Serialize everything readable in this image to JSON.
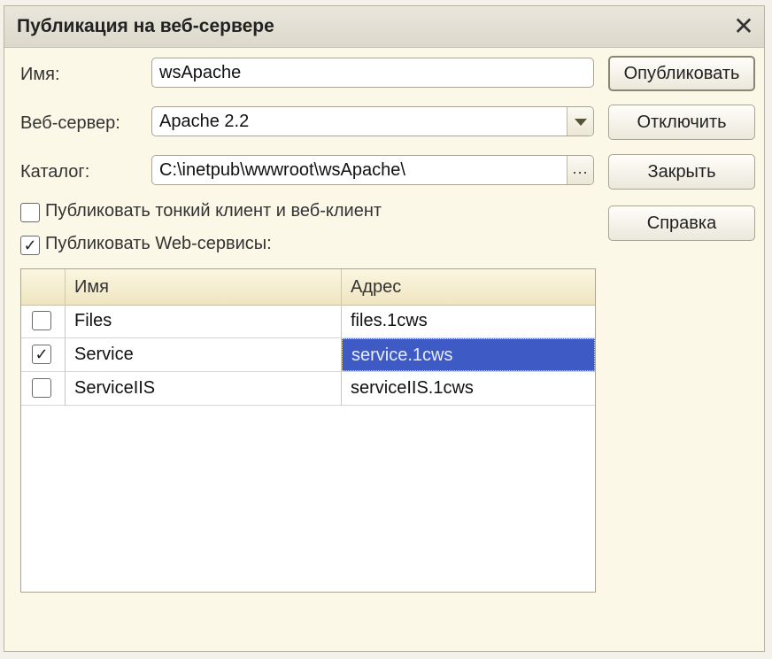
{
  "dialog": {
    "title": "Публикация на веб-сервере"
  },
  "form": {
    "name_label": "Имя:",
    "name_value": "wsApache",
    "server_label": "Веб-сервер:",
    "server_value": "Apache 2.2",
    "catalog_label": "Каталог:",
    "catalog_value": "C:\\inetpub\\wwwroot\\wsApache\\",
    "catalog_button": "..."
  },
  "buttons": {
    "publish": "Опубликовать",
    "disable": "Отключить",
    "close": "Закрыть",
    "help": "Справка"
  },
  "options": {
    "thin_client": {
      "label": "Публиковать тонкий клиент и веб-клиент",
      "checked": false
    },
    "web_services": {
      "label": "Публиковать Web-сервисы:",
      "checked": true
    }
  },
  "table": {
    "columns": [
      "Имя",
      "Адрес"
    ],
    "rows": [
      {
        "checked": false,
        "name": "Files",
        "address": "files.1cws",
        "selected": false
      },
      {
        "checked": true,
        "name": "Service",
        "address": "service.1cws",
        "selected": true
      },
      {
        "checked": false,
        "name": "ServiceIIS",
        "address": "serviceIIS.1cws",
        "selected": false
      }
    ]
  },
  "glyphs": {
    "check": "✓",
    "close": "✕"
  },
  "icons": {
    "close": "close-icon",
    "dropdown": "chevron-down-icon"
  },
  "colors": {
    "selection": "#3e5bc5",
    "background": "#fbf8e8"
  }
}
